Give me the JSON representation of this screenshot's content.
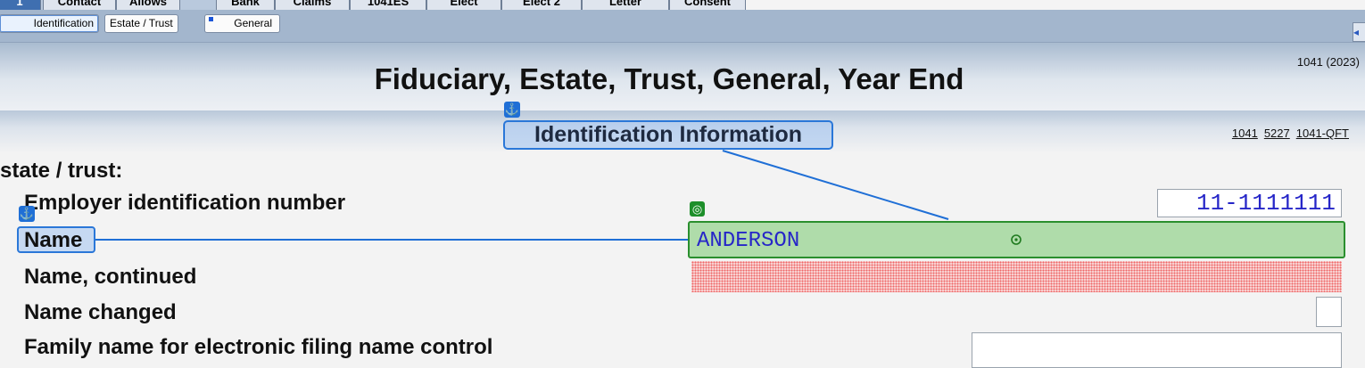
{
  "top_tabs": [
    {
      "label": "1",
      "active": true
    },
    {
      "label": "Contact"
    },
    {
      "label": "Allows"
    },
    {
      "label": "Bank"
    },
    {
      "label": "Claims"
    },
    {
      "label": "1041ES"
    },
    {
      "label": "Elect"
    },
    {
      "label": "Elect 2"
    },
    {
      "label": "Letter"
    },
    {
      "label": "Consent"
    }
  ],
  "sub_tabs": [
    {
      "label": "Identification",
      "active": true
    },
    {
      "label": "Estate / Trust"
    },
    {
      "label": "General"
    }
  ],
  "header": {
    "title": "Fiduciary, Estate, Trust, General, Year End",
    "form_code": "1041 (2023)"
  },
  "section": {
    "title": "Identification Information",
    "form_links": [
      "1041",
      "5227",
      "1041-QFT"
    ]
  },
  "labels": {
    "group": "state / trust:",
    "ein": "Employer identification number",
    "name": "Name",
    "name_continued": "Name, continued",
    "name_changed": "Name changed",
    "family_name": "Family name for electronic filing name control"
  },
  "fields": {
    "ein": "11-1111111",
    "name": "ANDERSON",
    "name_continued": "",
    "family_name": ""
  },
  "icons": {
    "anchor": "anchor-icon",
    "target": "target-icon",
    "cursor": "crosshair-icon"
  },
  "colors": {
    "link_highlight": "#2a77d8",
    "active_field": "#afdcaa",
    "active_field_border": "#2a8f2e",
    "error_field": "#f8d0d0",
    "field_text": "#2626c8"
  }
}
